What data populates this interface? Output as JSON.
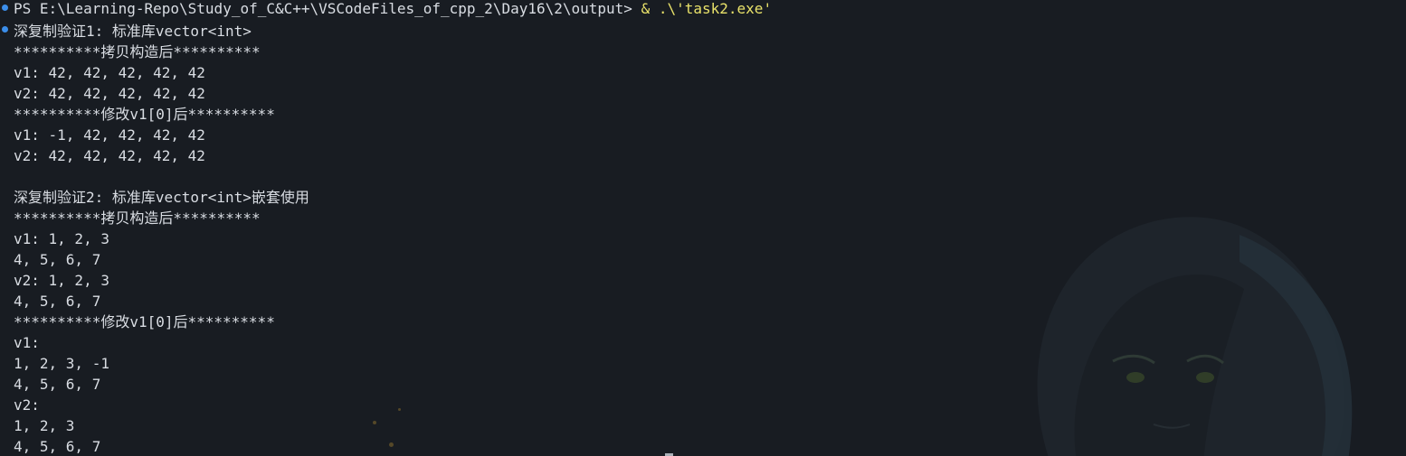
{
  "terminal": {
    "prompt": "PS E:\\Learning-Repo\\Study_of_C&C++\\VSCodeFiles_of_cpp_2\\Day16\\2\\output>",
    "command": "& .\\'task2.exe'",
    "lines": [
      "深复制验证1: 标准库vector<int>",
      "**********拷贝构造后**********",
      "v1: 42, 42, 42, 42, 42",
      "v2: 42, 42, 42, 42, 42",
      "**********修改v1[0]后**********",
      "v1: -1, 42, 42, 42, 42",
      "v2: 42, 42, 42, 42, 42",
      "",
      "深复制验证2: 标准库vector<int>嵌套使用",
      "**********拷贝构造后**********",
      "v1: 1, 2, 3",
      "4, 5, 6, 7",
      "v2: 1, 2, 3",
      "4, 5, 6, 7",
      "**********修改v1[0]后**********",
      "v1:",
      "1, 2, 3, -1",
      "4, 5, 6, 7",
      "v2:",
      "1, 2, 3",
      "4, 5, 6, 7"
    ]
  },
  "colors": {
    "background": "#181c22",
    "text": "#d9dde3",
    "command_exe": "#e9e26a",
    "decoration_mark": "#3b8eea"
  }
}
